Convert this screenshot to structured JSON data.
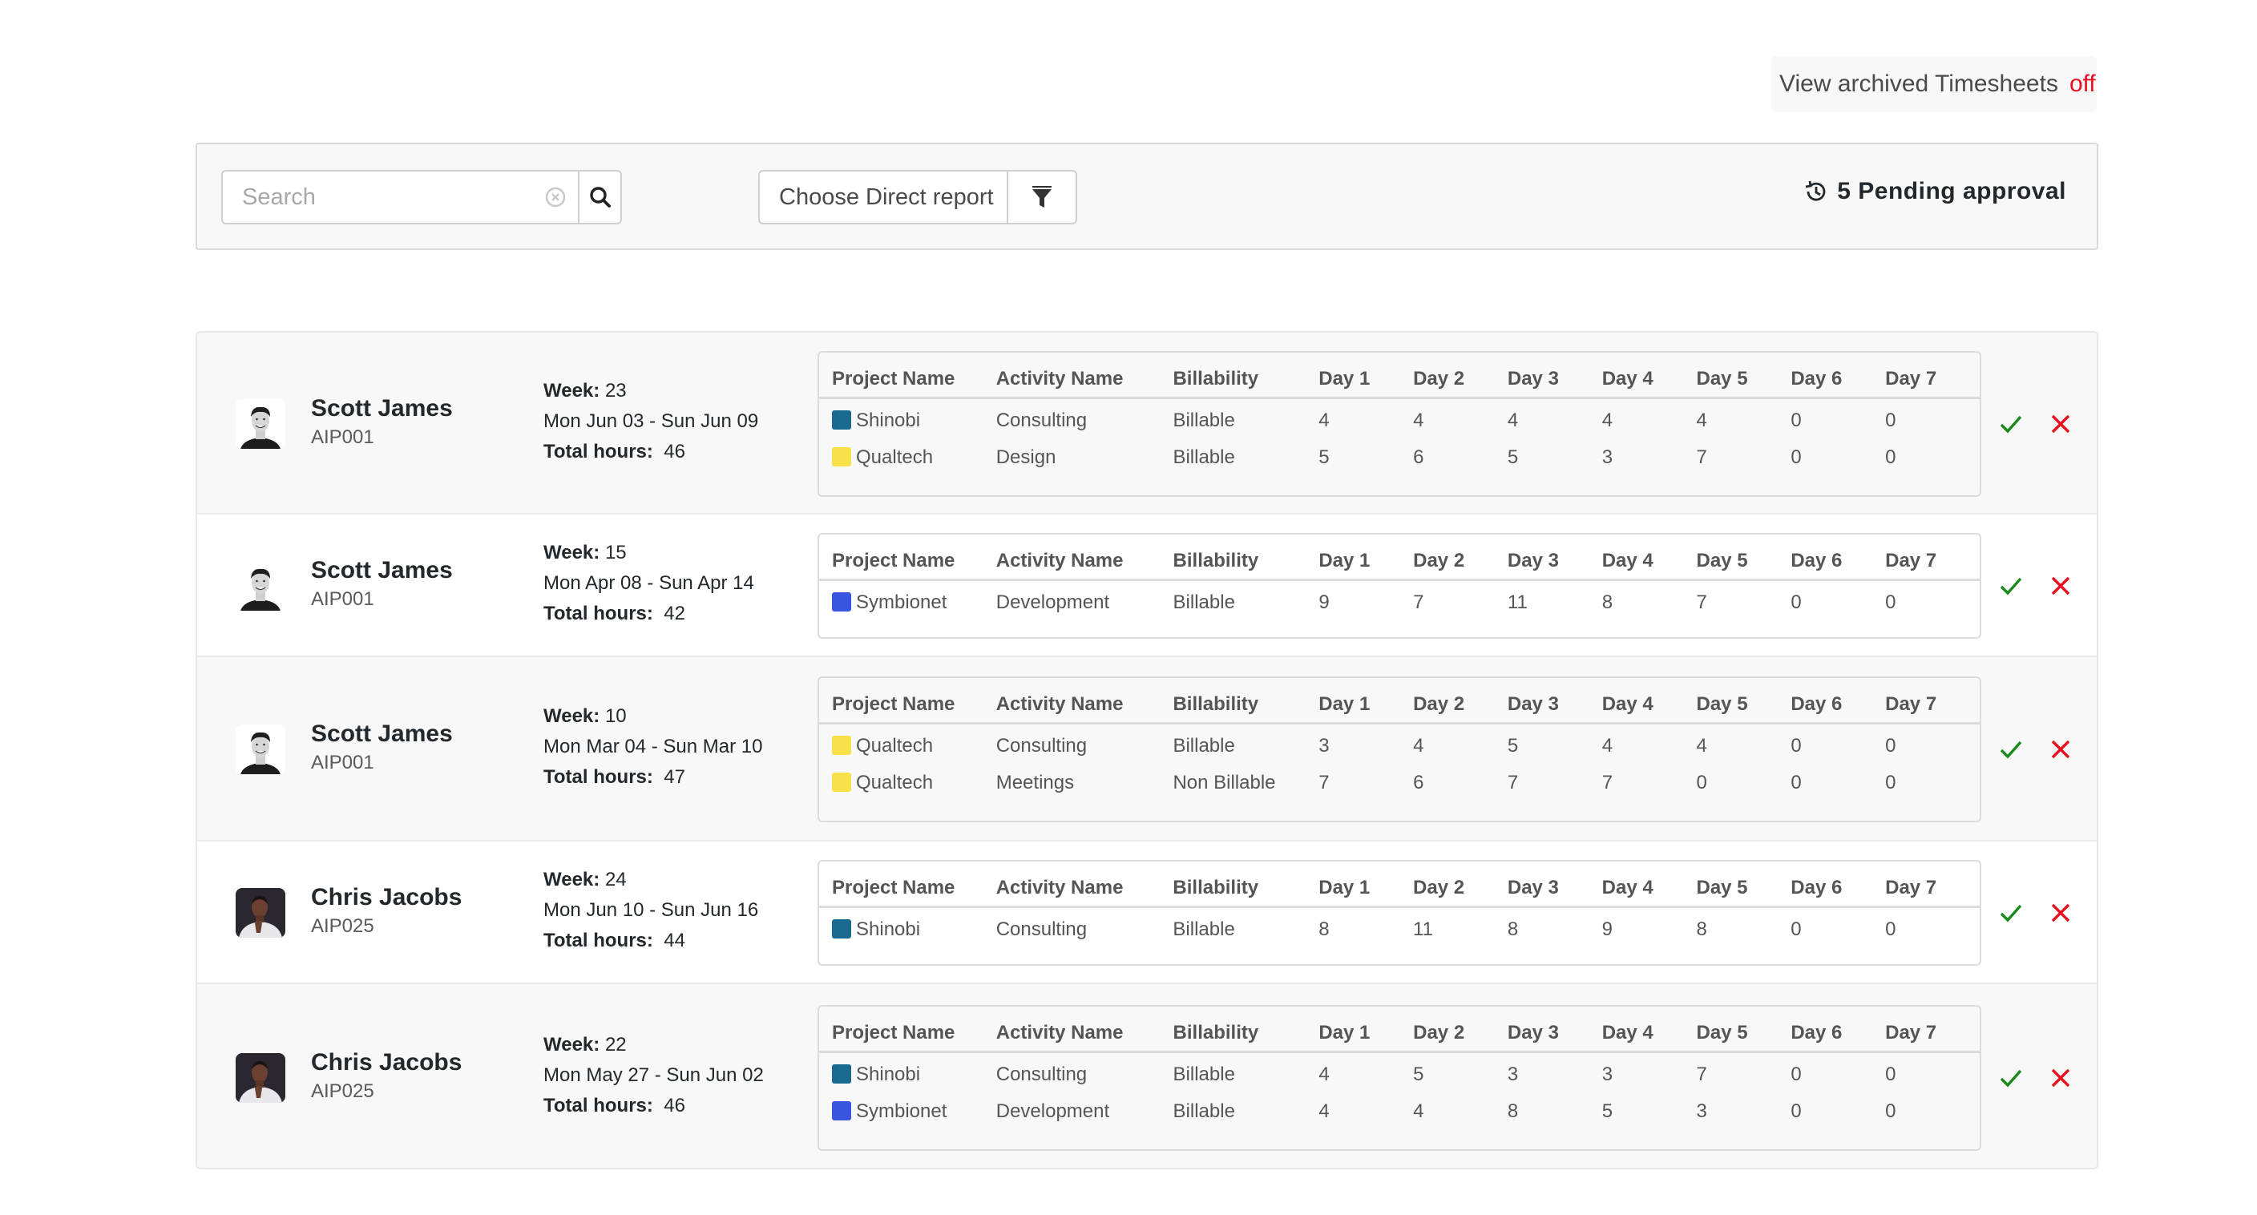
{
  "archived": {
    "label": "View archived Timesheets",
    "state": "off",
    "state_color": "#e8101e"
  },
  "filters": {
    "search_placeholder": "Search",
    "search_value": "",
    "direct_report_label": "Choose Direct report",
    "pending_label": "5 Pending approval"
  },
  "columns": [
    "Project Name",
    "Activity Name",
    "Billability",
    "Day 1",
    "Day 2",
    "Day 3",
    "Day 4",
    "Day 5",
    "Day 6",
    "Day 7"
  ],
  "project_colors": {
    "Shinobi": "#1a6a8f",
    "Qualtech": "#f7e04a",
    "Symbionet": "#3a55e0"
  },
  "status_colors": {
    "approve": "#1a8a1a",
    "reject": "#e8101e"
  },
  "timesheets": [
    {
      "name": "Scott James",
      "code": "AIP001",
      "avatar": "avatar-scott",
      "week_label": "Week:",
      "week": "23",
      "range": "Mon Jun 03 - Sun Jun 09",
      "total_label": "Total hours:",
      "total": "46",
      "rows": [
        {
          "project": "Shinobi",
          "activity": "Consulting",
          "billability": "Billable",
          "days": [
            "4",
            "4",
            "4",
            "4",
            "4",
            "0",
            "0"
          ]
        },
        {
          "project": "Qualtech",
          "activity": "Design",
          "billability": "Billable",
          "days": [
            "5",
            "6",
            "5",
            "3",
            "7",
            "0",
            "0"
          ]
        }
      ]
    },
    {
      "name": "Scott James",
      "code": "AIP001",
      "avatar": "avatar-scott",
      "week_label": "Week:",
      "week": "15",
      "range": "Mon Apr 08 - Sun Apr 14",
      "total_label": "Total hours:",
      "total": "42",
      "rows": [
        {
          "project": "Symbionet",
          "activity": "Development",
          "billability": "Billable",
          "days": [
            "9",
            "7",
            "11",
            "8",
            "7",
            "0",
            "0"
          ]
        }
      ]
    },
    {
      "name": "Scott James",
      "code": "AIP001",
      "avatar": "avatar-scott",
      "week_label": "Week:",
      "week": "10",
      "range": "Mon Mar 04 - Sun Mar 10",
      "total_label": "Total hours:",
      "total": "47",
      "rows": [
        {
          "project": "Qualtech",
          "activity": "Consulting",
          "billability": "Billable",
          "days": [
            "3",
            "4",
            "5",
            "4",
            "4",
            "0",
            "0"
          ]
        },
        {
          "project": "Qualtech",
          "activity": "Meetings",
          "billability": "Non Billable",
          "days": [
            "7",
            "6",
            "7",
            "7",
            "0",
            "0",
            "0"
          ]
        }
      ]
    },
    {
      "name": "Chris Jacobs",
      "code": "AIP025",
      "avatar": "avatar-chris",
      "week_label": "Week:",
      "week": "24",
      "range": "Mon Jun 10 - Sun Jun 16",
      "total_label": "Total hours:",
      "total": "44",
      "rows": [
        {
          "project": "Shinobi",
          "activity": "Consulting",
          "billability": "Billable",
          "days": [
            "8",
            "11",
            "8",
            "9",
            "8",
            "0",
            "0"
          ]
        }
      ]
    },
    {
      "name": "Chris Jacobs",
      "code": "AIP025",
      "avatar": "avatar-chris",
      "week_label": "Week:",
      "week": "22",
      "range": "Mon May 27 - Sun Jun 02",
      "total_label": "Total hours:",
      "total": "46",
      "rows": [
        {
          "project": "Shinobi",
          "activity": "Consulting",
          "billability": "Billable",
          "days": [
            "4",
            "5",
            "3",
            "3",
            "7",
            "0",
            "0"
          ]
        },
        {
          "project": "Symbionet",
          "activity": "Development",
          "billability": "Billable",
          "days": [
            "4",
            "4",
            "8",
            "5",
            "3",
            "0",
            "0"
          ]
        }
      ]
    }
  ]
}
